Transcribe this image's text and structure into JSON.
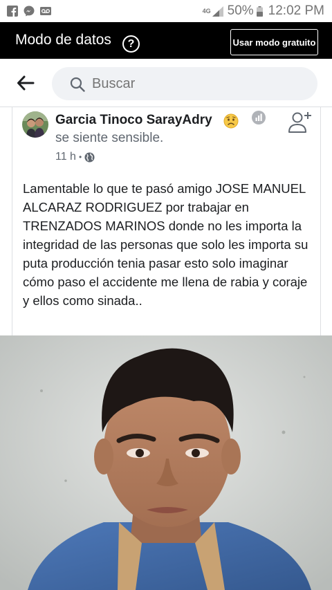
{
  "status_bar": {
    "network": "4G",
    "battery": "50%",
    "time": "12:02 PM",
    "icons": [
      "facebook-icon",
      "messenger-icon",
      "voicemail-icon",
      "signal-icon",
      "battery-icon"
    ]
  },
  "data_mode": {
    "title": "Modo de datos",
    "help": "?",
    "free_button": "Usar modo gratuito"
  },
  "search": {
    "placeholder": "Buscar"
  },
  "post": {
    "author": "Garcia Tinoco SarayAdry",
    "feeling": "se siente sensible.",
    "time": "11 h",
    "separator": "•",
    "body": "Lamentable lo que te pasó amigo JOSE MANUEL ALCARAZ RODRIGUEZ por trabajar en TRENZADOS MARINOS donde no les importa la integridad de las personas que solo les importa su puta producción tenia pasar esto solo imaginar cómo paso el accidente me llena de rabia y coraje  y ellos como sinada.."
  },
  "colors": {
    "data_bar": "#000000",
    "search_pill": "#f0f2f5",
    "text_primary": "#1c1e21",
    "text_secondary": "#606770"
  }
}
